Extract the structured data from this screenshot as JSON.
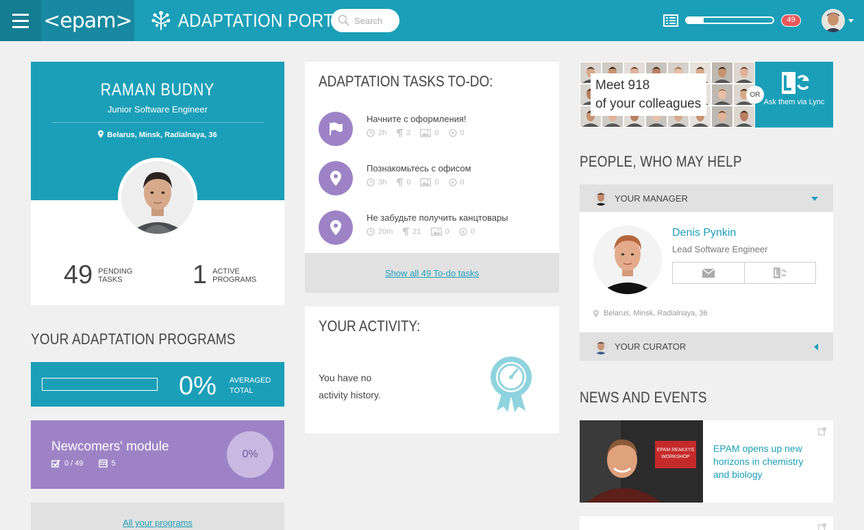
{
  "header": {
    "logo_text": "<epam>",
    "portal_title": "ADAPTATION PORTAL",
    "search_placeholder": "Search",
    "progress_fraction": 0.2,
    "notification_count": "49"
  },
  "profile": {
    "name": "RAMAN BUDNY",
    "role": "Junior Software Engineer",
    "location": "Belarus, Minsk, Radialnaya, 36",
    "pending_count": "49",
    "pending_label_1": "PENDING",
    "pending_label_2": "TASKS",
    "active_count": "1",
    "active_label_1": "ACTIVE",
    "active_label_2": "PROGRAMS"
  },
  "programs": {
    "section_title": "YOUR ADAPTATION PROGRAMS",
    "averaged_percent": "0%",
    "averaged_label_1": "AVERAGED",
    "averaged_label_2": "TOTAL",
    "module_title": "Newcomers' module",
    "module_tasks": "0 / 49",
    "module_days": "5",
    "module_percent": "0%",
    "all_link": "All your programs"
  },
  "tasks": {
    "title": "ADAPTATION TASKS TO-DO:",
    "items": [
      {
        "title": "Начните с оформления!",
        "time": "2h",
        "paragraphs": "2",
        "images": "0",
        "videos": "0",
        "icon": "flag-icon"
      },
      {
        "title": "Познакомьтесь с офисом",
        "time": "3h",
        "paragraphs": "0",
        "images": "0",
        "videos": "0",
        "icon": "map-pin-icon"
      },
      {
        "title": "Не забудьте получить канцтовары",
        "time": "20m",
        "paragraphs": "21",
        "images": "0",
        "videos": "0",
        "icon": "map-pin-icon"
      }
    ],
    "show_all": "Show all 49 To-do tasks"
  },
  "activity": {
    "title": "YOUR ACTIVITY:",
    "empty_text": "You have no activity history."
  },
  "colleagues": {
    "meet_line1": "Meet 918",
    "meet_line2": "of your colleagues",
    "or": "OR",
    "lync_label": "Ask them via Lync"
  },
  "people": {
    "section_title": "PEOPLE, WHO MAY HELP",
    "manager_header": "YOUR MANAGER",
    "manager_name": "Denis Pynkin",
    "manager_role": "Lead Software Engineer",
    "manager_location": "Belarus, Minsk, Radialnaya, 36",
    "curator_header": "YOUR CURATOR"
  },
  "news": {
    "section_title": "NEWS AND EVENTS",
    "item1_title": "EPAM opens up new horizons in chemistry and biology",
    "item1_sign": "EPAM REAKXYS WORKSHOP"
  },
  "colors": {
    "teal": "#1b9fb8",
    "teal_dark": "#157d91",
    "purple": "#9d83c6",
    "badge_red": "#e9595b",
    "gray_panel": "#e1e1e1"
  }
}
